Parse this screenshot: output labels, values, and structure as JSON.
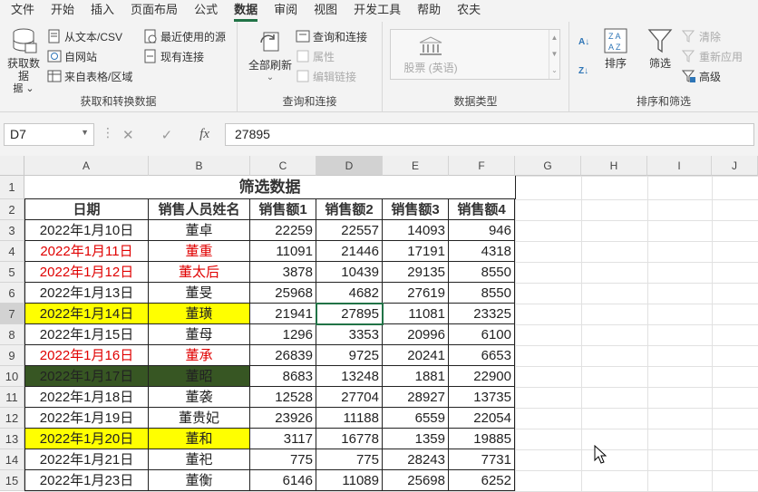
{
  "menu": [
    "文件",
    "开始",
    "插入",
    "页面布局",
    "公式",
    "数据",
    "审阅",
    "视图",
    "开发工具",
    "帮助",
    "农夫"
  ],
  "ribbon": {
    "get_data": "获取数据",
    "get_data_sub": "据",
    "from_text": "从文本/CSV",
    "from_web": "自网站",
    "from_table": "来自表格/区域",
    "recent_sources": "最近使用的源",
    "existing_conn": "现有连接",
    "group1": "获取和转换数据",
    "refresh_all": "全部刷新",
    "queries_conn": "查询和连接",
    "properties": "属性",
    "edit_links": "编辑链接",
    "group2": "查询和连接",
    "stocks": "股票 (英语)",
    "group3": "数据类型",
    "sort": "排序",
    "filter": "筛选",
    "clear": "清除",
    "reapply": "重新应用",
    "advanced": "高级",
    "group4": "排序和筛选"
  },
  "formula": {
    "namebox": "D7",
    "value": "27895",
    "fx": "fx"
  },
  "columns": [
    "A",
    "B",
    "C",
    "D",
    "E",
    "F",
    "G",
    "H",
    "I",
    "J"
  ],
  "rows": [
    "1",
    "2",
    "3",
    "4",
    "5",
    "6",
    "7",
    "8",
    "9",
    "10",
    "11",
    "12",
    "13",
    "14",
    "15"
  ],
  "title": "筛选数据",
  "headers": [
    "日期",
    "销售人员姓名",
    "销售额1",
    "销售额2",
    "销售额3",
    "销售额4"
  ],
  "data": [
    [
      "2022年1月10日",
      "董卓",
      "22259",
      "22557",
      "14093",
      "946"
    ],
    [
      "2022年1月11日",
      "董重",
      "11091",
      "21446",
      "17191",
      "4318"
    ],
    [
      "2022年1月12日",
      "董太后",
      "3878",
      "10439",
      "29135",
      "8550"
    ],
    [
      "2022年1月13日",
      "董旻",
      "25968",
      "4682",
      "27619",
      "8550"
    ],
    [
      "2022年1月14日",
      "董璜",
      "21941",
      "27895",
      "11081",
      "23325"
    ],
    [
      "2022年1月15日",
      "董母",
      "1296",
      "3353",
      "20996",
      "6100"
    ],
    [
      "2022年1月16日",
      "董承",
      "26839",
      "9725",
      "20241",
      "6653"
    ],
    [
      "2022年1月17日",
      "董昭",
      "8683",
      "13248",
      "1881",
      "22900"
    ],
    [
      "2022年1月18日",
      "董袭",
      "12528",
      "27704",
      "28927",
      "13735"
    ],
    [
      "2022年1月19日",
      "董贵妃",
      "23926",
      "11188",
      "6559",
      "22054"
    ],
    [
      "2022年1月20日",
      "董和",
      "3117",
      "16778",
      "1359",
      "19885"
    ],
    [
      "2022年1月21日",
      "董祀",
      "775",
      "775",
      "28243",
      "7731"
    ],
    [
      "2022年1月23日",
      "董衡",
      "6146",
      "11089",
      "25698",
      "6252"
    ]
  ],
  "row_styles": [
    "normal",
    "red",
    "red",
    "normal",
    "yellow",
    "normal",
    "red",
    "darkgreen",
    "normal",
    "normal",
    "yellow",
    "normal",
    "normal"
  ],
  "colors": {
    "accent": "#217346",
    "red": "#e00000",
    "yellow": "#ffff00",
    "darkgreen": "#375623"
  }
}
